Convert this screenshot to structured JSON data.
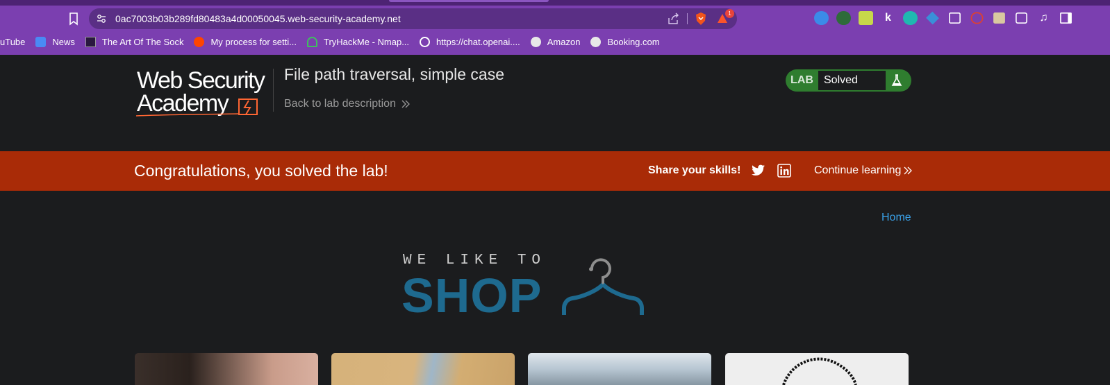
{
  "browser": {
    "url": "0ac7003b03b289fd80483a4d00050045.web-security-academy.net",
    "notification_count": "1",
    "bookmarks": [
      {
        "label": "uTube"
      },
      {
        "label": "News"
      },
      {
        "label": "The Art Of The Sock"
      },
      {
        "label": "My process for setti..."
      },
      {
        "label": "TryHackMe - Nmap..."
      },
      {
        "label": "https://chat.openai...."
      },
      {
        "label": "Amazon"
      },
      {
        "label": "Booking.com"
      }
    ]
  },
  "lab": {
    "logo_line1": "Web Security",
    "logo_line2": "Academy",
    "title": "File path traversal, simple case",
    "back_link": "Back to lab description",
    "status_tag": "LAB",
    "status": "Solved"
  },
  "banner": {
    "message": "Congratulations, you solved the lab!",
    "share_label": "Share your skills!",
    "continue_label": "Continue learning"
  },
  "nav": {
    "home": "Home"
  },
  "shop_logo": {
    "tagline": "WE LIKE TO",
    "word": "SHOP"
  },
  "colors": {
    "browser_chrome": "#7b3fb0",
    "banner": "#a92b07",
    "solved_green": "#2f7d2f",
    "shop_blue": "#1e6a8f",
    "link_blue": "#3aa0e6"
  }
}
